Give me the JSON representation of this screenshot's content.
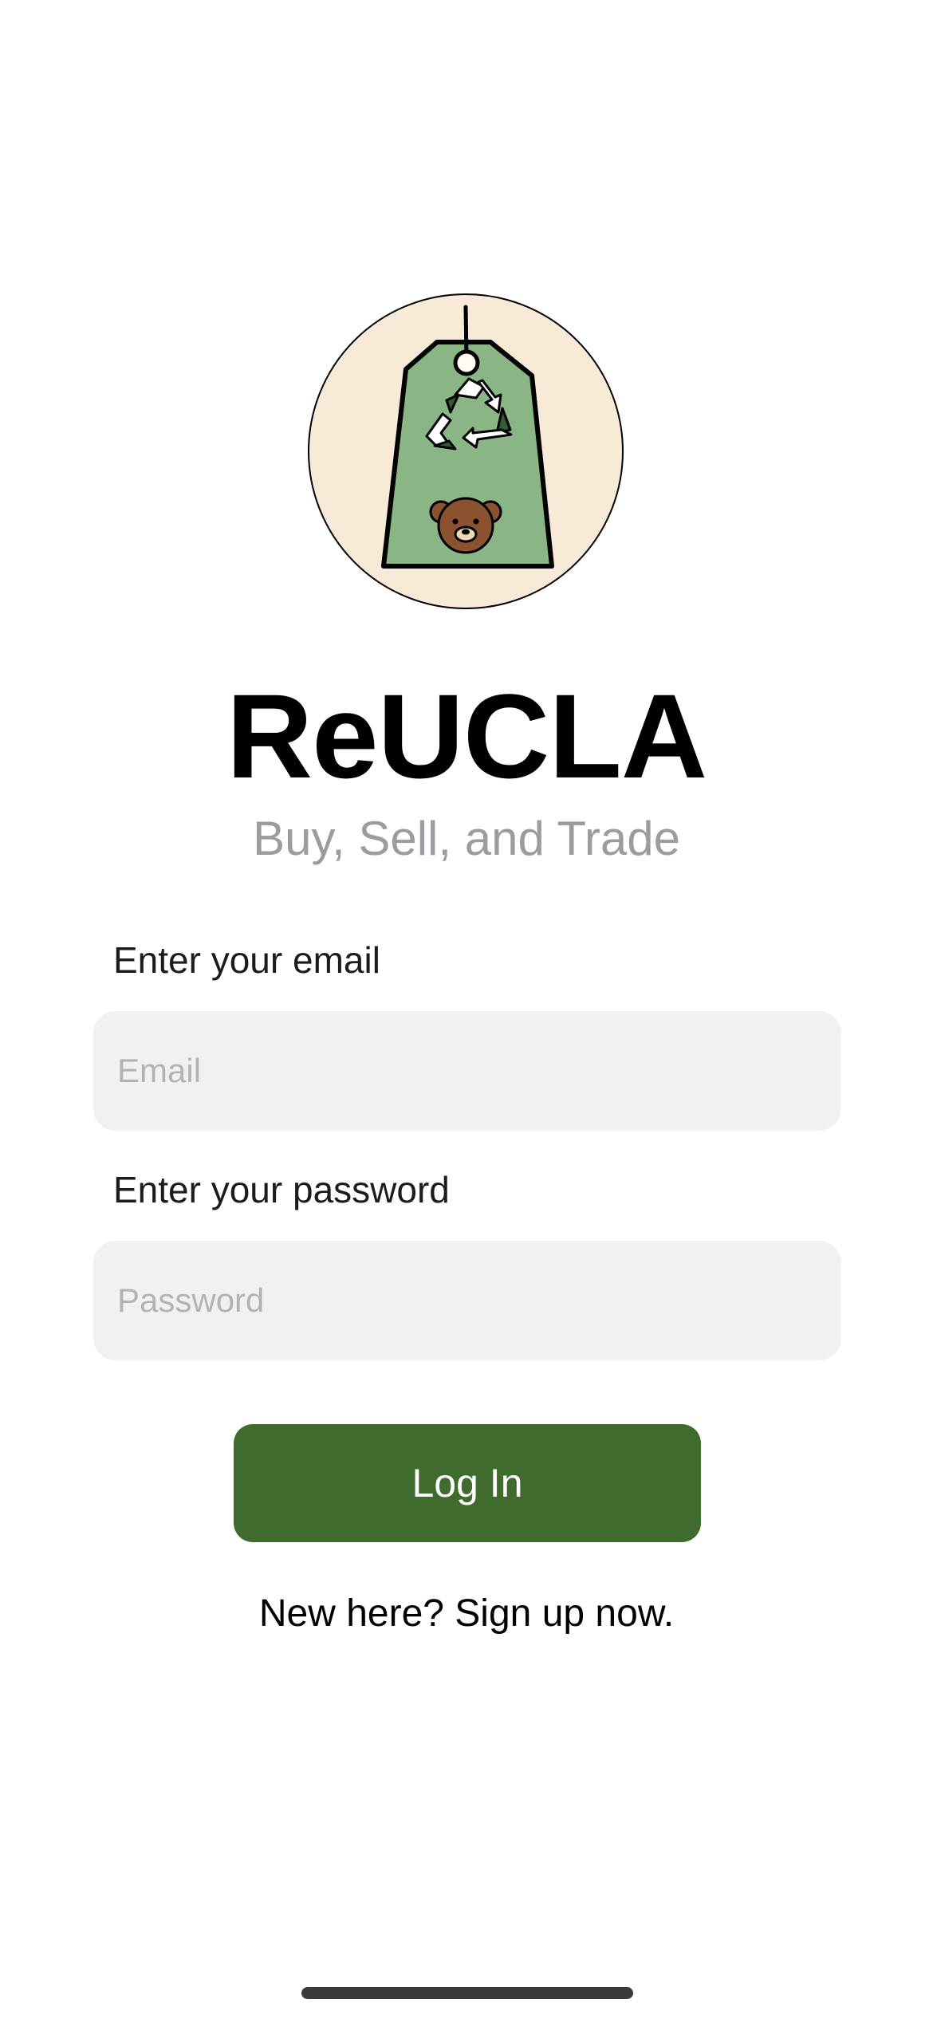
{
  "app": {
    "title": "ReUCLA",
    "subtitle": "Buy, Sell, and Trade"
  },
  "logo": {
    "icon": "price-tag-recycle-bear-icon",
    "colors": {
      "circle_background": "#f7ead7",
      "tag": "#8ab584",
      "recycle_dark": "#2e5e35",
      "bear": "#8b5230"
    }
  },
  "form": {
    "email": {
      "label": "Enter your email",
      "placeholder": "Email",
      "value": ""
    },
    "password": {
      "label": "Enter your password",
      "placeholder": "Password",
      "value": ""
    },
    "login_label": "Log In",
    "signup_text": "New here? Sign up now."
  },
  "colors": {
    "accent": "#406b2e",
    "input_background": "#f1f1f1",
    "subtitle": "#9b9ba0"
  }
}
